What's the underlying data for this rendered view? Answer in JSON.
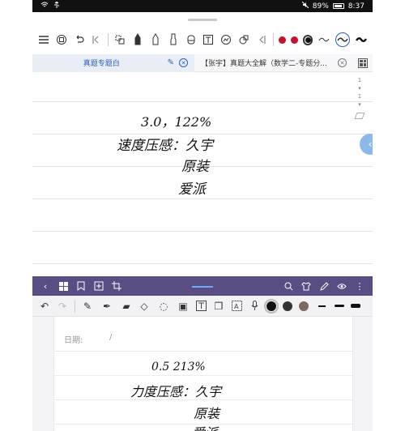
{
  "status": {
    "left_icons": [
      "wifi-icon",
      "usb-icon"
    ],
    "battery_pct": "89%",
    "time": "8:37"
  },
  "top_window": {
    "toolbar_icons": [
      "menu-icon",
      "save-icon",
      "undo-icon",
      "collapse-icon",
      "lasso-icon",
      "pen-icon",
      "pen-alt-icon",
      "highlighter-icon",
      "eraser-icon",
      "text-icon",
      "image-icon",
      "shape-icon",
      "chevron-left-icon"
    ],
    "pen_colors": [
      "#c8102e",
      "#c8102e",
      "#111111"
    ],
    "accent": "#2a5fb8",
    "tabs": [
      {
        "label": "真题专题白",
        "active": true
      },
      {
        "label": "【张宇】真题大全解（数学二-专题分...",
        "active": false
      }
    ],
    "page_numbers": [
      "1",
      "1"
    ],
    "handwriting": {
      "line1": "3.0，122%",
      "line2": "速度压感：久宇",
      "line3": "原装",
      "line4": "爱派"
    }
  },
  "bottom_window": {
    "nav_color": "#5a4d83",
    "swatches": [
      "#111111",
      "#333333",
      "#7a6a62",
      "#cfcfcf"
    ],
    "date_label": "日期:",
    "date_sep": "/",
    "handwriting": {
      "line1": "0.5  213%",
      "line2": "力度压感：久宇",
      "line3": "原装",
      "line4": "爱派"
    }
  }
}
